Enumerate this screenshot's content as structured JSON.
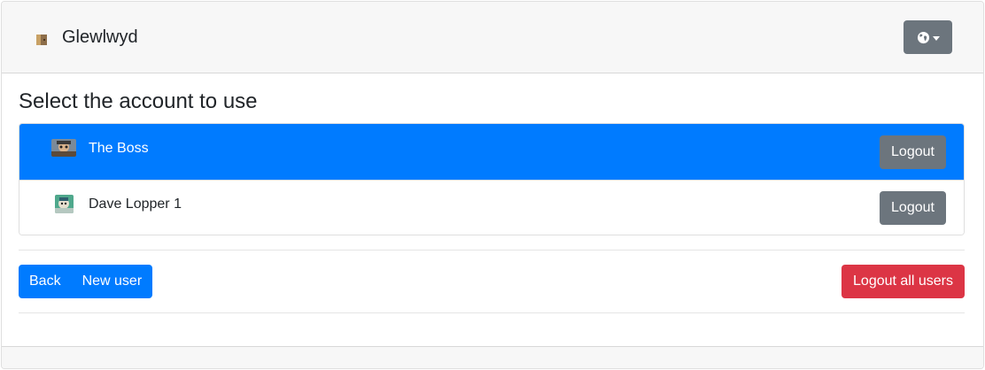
{
  "header": {
    "brand_name": "Glewlwyd",
    "logo_icon": "door-icon",
    "language_icon": "globe-icon"
  },
  "main": {
    "title": "Select the account to use",
    "accounts": [
      {
        "name": "The Boss",
        "logout_label": "Logout",
        "active": true,
        "avatar_icon": "user-avatar"
      },
      {
        "name": "Dave Lopper 1",
        "logout_label": "Logout",
        "active": false,
        "avatar_icon": "user-avatar"
      }
    ],
    "actions": {
      "back_label": "Back",
      "new_user_label": "New user",
      "logout_all_label": "Logout all users"
    }
  },
  "colors": {
    "primary": "#007bff",
    "secondary": "#6c757d",
    "danger": "#dc3545"
  }
}
